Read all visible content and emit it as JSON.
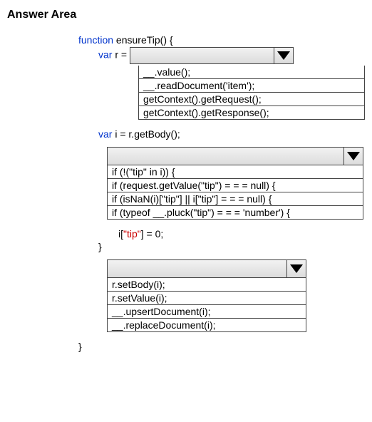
{
  "title": "Answer Area",
  "code": {
    "funcDecl_kw": "function",
    "funcDecl_name": " ensureTip() {",
    "var_r_kw": "var",
    "var_r_rest": " r = ",
    "var_i_kw": "var",
    "var_i_rest": " i = r.getBody();",
    "assign_prefix": "i[",
    "assign_key": "\"tip\"",
    "assign_suffix": "] = 0;",
    "closeBrace1": "}",
    "closeBrace2": "}"
  },
  "dropdown1": {
    "options": [
      "__.value();",
      "__.readDocument('item');",
      "getContext().getRequest();",
      "getContext().getResponse();"
    ]
  },
  "dropdown2": {
    "options": [
      "if (!(\"tip\" in i)) {",
      "if (request.getValue(\"tip\") = = = null) {",
      "if (isNaN(i)[\"tip\"] || i[\"tip\"] = = = null) {",
      "if (typeof __.pluck(\"tip\") = = = 'number') {"
    ]
  },
  "dropdown3": {
    "options": [
      "r.setBody(i);",
      "r.setValue(i);",
      "__.upsertDocument(i);",
      "__.replaceDocument(i);"
    ]
  }
}
